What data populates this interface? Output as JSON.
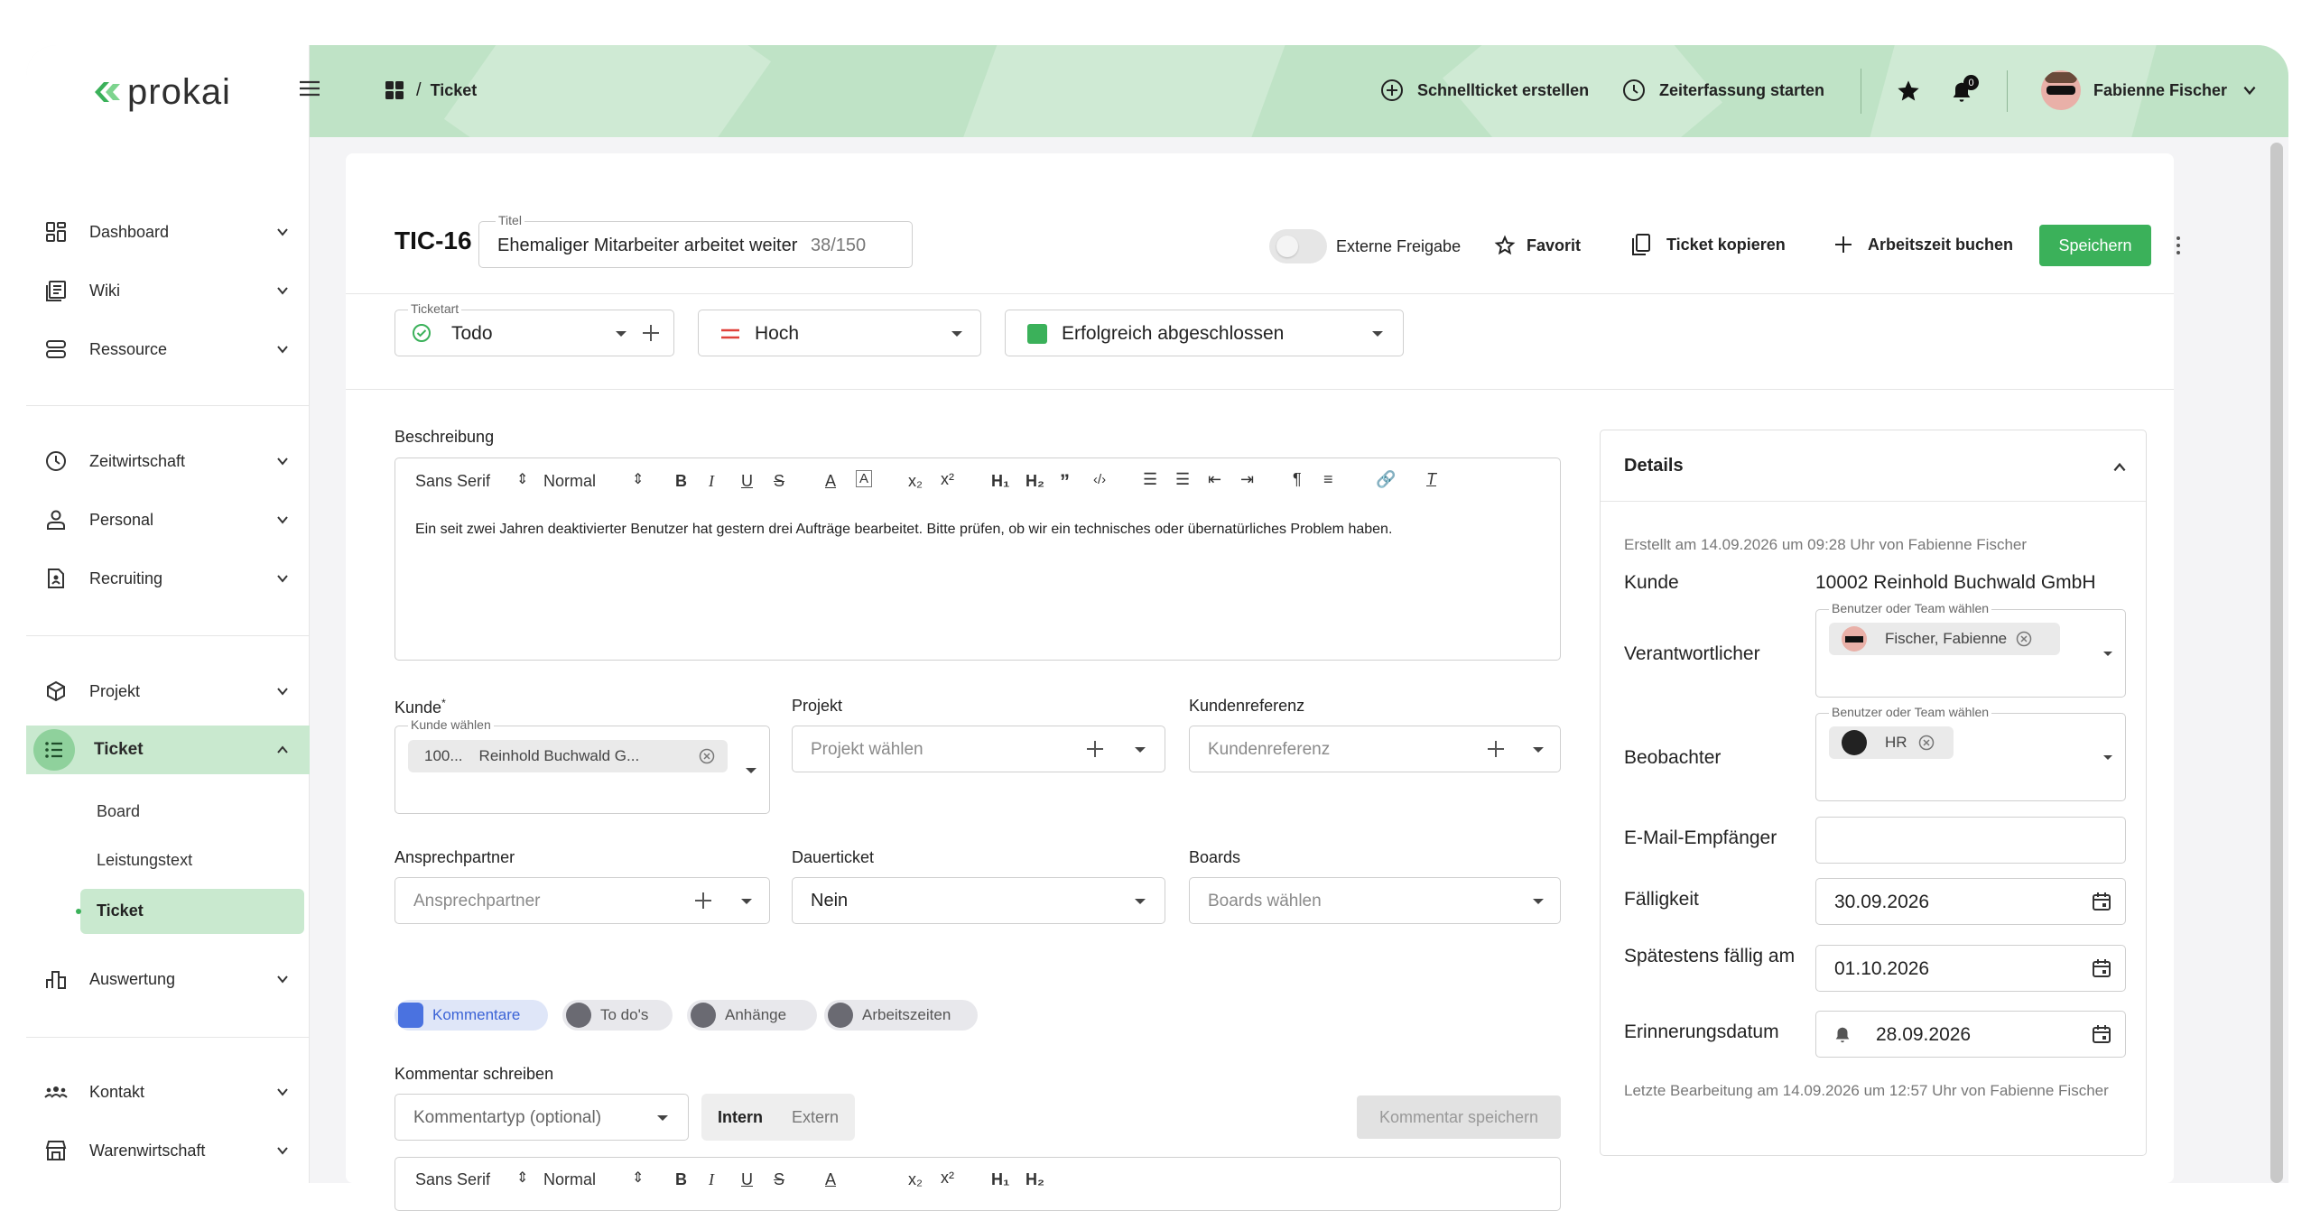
{
  "app": {
    "logo_text": "prokai"
  },
  "header": {
    "breadcrumb_sep": "/",
    "breadcrumb_current": "Ticket",
    "quick_ticket": "Schnellticket erstellen",
    "time_tracking": "Zeiterfassung starten",
    "notification_count": "0",
    "user_name": "Fabienne Fischer"
  },
  "sidebar": {
    "items": [
      {
        "label": "Dashboard"
      },
      {
        "label": "Wiki"
      },
      {
        "label": "Ressource"
      },
      {
        "label": "Zeitwirtschaft"
      },
      {
        "label": "Personal"
      },
      {
        "label": "Recruiting"
      },
      {
        "label": "Projekt"
      },
      {
        "label": "Ticket"
      },
      {
        "label": "Auswertung"
      },
      {
        "label": "Kontakt"
      },
      {
        "label": "Warenwirtschaft"
      }
    ],
    "sub_items": [
      {
        "label": "Board"
      },
      {
        "label": "Leistungstext"
      },
      {
        "label": "Ticket"
      }
    ]
  },
  "ticket": {
    "id": "TIC-16",
    "title_label": "Titel",
    "title_value": "Ehemaliger Mitarbeiter arbeitet weiter",
    "title_count": "38/150",
    "external_share": "Externe Freigabe",
    "favorite": "Favorit",
    "copy": "Ticket kopieren",
    "book_time": "Arbeitszeit buchen",
    "save": "Speichern",
    "type_label": "Ticketart",
    "type_value": "Todo",
    "priority_value": "Hoch",
    "status_value": "Erfolgreich abgeschlossen",
    "status_color": "#3bb15a"
  },
  "editor": {
    "label": "Beschreibung",
    "font": "Sans Serif",
    "size": "Normal",
    "text": "Ein seit zwei Jahren deaktivierter Benutzer hat gestern drei Aufträge bearbeitet. Bitte prüfen, ob wir ein technisches oder übernatürliches Problem haben."
  },
  "form": {
    "customer_label": "Kunde",
    "customer_required": "*",
    "customer_inner_label": "Kunde wählen",
    "customer_chip_num": "100...",
    "customer_chip_name": "Reinhold Buchwald G...",
    "project_label": "Projekt",
    "project_placeholder": "Projekt wählen",
    "custref_label": "Kundenreferenz",
    "custref_placeholder": "Kundenreferenz",
    "contact_label": "Ansprechpartner",
    "contact_placeholder": "Ansprechpartner",
    "permanent_label": "Dauerticket",
    "permanent_value": "Nein",
    "boards_label": "Boards",
    "boards_placeholder": "Boards wählen"
  },
  "tabs": [
    {
      "label": "Kommentare"
    },
    {
      "label": "To do's"
    },
    {
      "label": "Anhänge"
    },
    {
      "label": "Arbeitszeiten"
    }
  ],
  "comment": {
    "label": "Kommentar schreiben",
    "type_placeholder": "Kommentartyp (optional)",
    "intern": "Intern",
    "extern": "Extern",
    "save": "Kommentar speichern"
  },
  "details": {
    "title": "Details",
    "created": "Erstellt am 14.09.2026 um 09:28 Uhr von Fabienne Fischer",
    "customer_label": "Kunde",
    "customer_value": "10002 Reinhold Buchwald GmbH",
    "responsible_label": "Verantwortlicher",
    "user_team_label": "Benutzer oder Team wählen",
    "responsible_value": "Fischer, Fabienne",
    "observer_label": "Beobachter",
    "observer_value": "HR",
    "email_label": "E-Mail-Empfänger",
    "due_label": "Fälligkeit",
    "due_value": "30.09.2026",
    "latest_label": "Spätestens fällig am",
    "latest_value": "01.10.2026",
    "reminder_label": "Erinnerungsdatum",
    "reminder_value": "28.09.2026",
    "last_edit": "Letzte Bearbeitung am 14.09.2026 um 12:57 Uhr von Fabienne Fischer"
  }
}
